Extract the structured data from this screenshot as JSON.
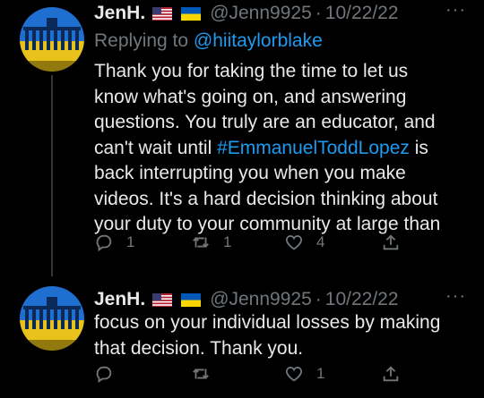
{
  "tweets": [
    {
      "name": "JenH.",
      "handle": "@Jenn9925",
      "separator": "·",
      "date": "10/22/22",
      "more": "···",
      "replying_prefix": "Replying to ",
      "replying_to": "@hiitaylorblake",
      "lines": [
        {
          "a": "Thank you for taking the time to let us",
          "tag": "",
          "b": ""
        },
        {
          "a": "know what's going on, and answering",
          "tag": "",
          "b": ""
        },
        {
          "a": "questions. You truly are an educator, and",
          "tag": "",
          "b": ""
        },
        {
          "a": "can't wait until ",
          "tag": "#EmmanuelToddLopez",
          "b": " is"
        },
        {
          "a": "back interrupting you when you make",
          "tag": "",
          "b": ""
        },
        {
          "a": "videos. It's a hard decision thinking about",
          "tag": "",
          "b": ""
        },
        {
          "a": "your duty to your community at large than",
          "tag": "",
          "b": ""
        }
      ],
      "counts": {
        "reply": "1",
        "retweet": "1",
        "like": "4"
      }
    },
    {
      "name": "JenH.",
      "handle": "@Jenn9925",
      "separator": "·",
      "date": "10/22/22",
      "more": "···",
      "lines": [
        {
          "a": "focus on your individual losses by making",
          "tag": "",
          "b": ""
        },
        {
          "a": "that decision. Thank you.",
          "tag": "",
          "b": ""
        }
      ],
      "counts": {
        "reply": "",
        "retweet": "",
        "like": "1"
      }
    }
  ],
  "icons": {
    "reply": "reply-bubble-icon",
    "retweet": "retweet-icon",
    "like": "heart-icon",
    "share": "share-icon"
  },
  "colors": {
    "background": "#000000",
    "text": "#e7e9ea",
    "muted": "#71767b",
    "link": "#1d9bf0"
  }
}
